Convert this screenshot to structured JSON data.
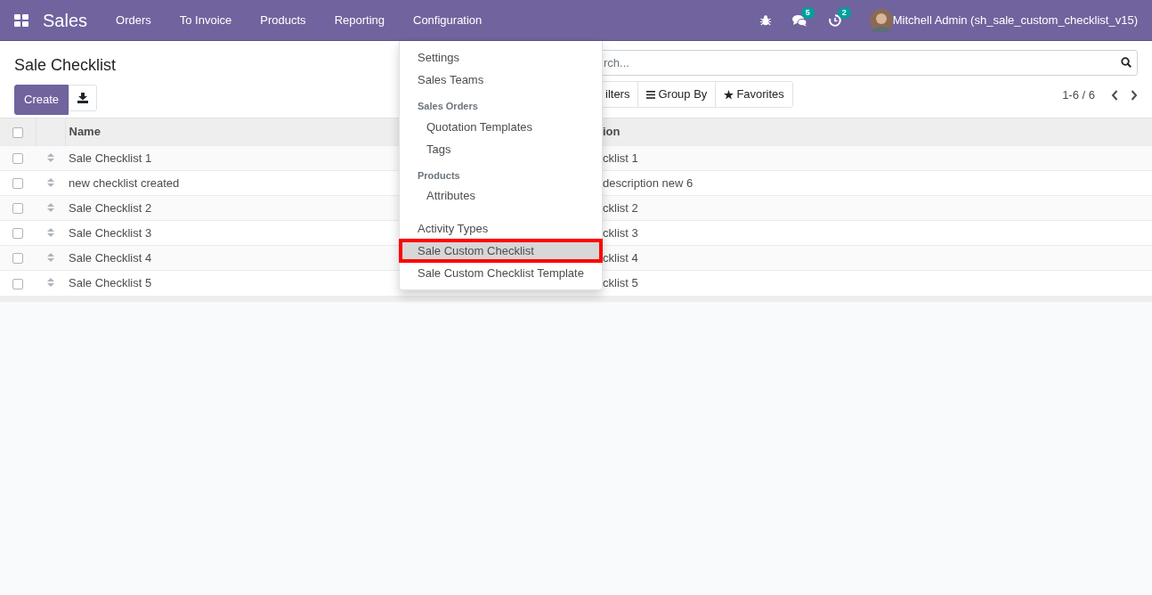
{
  "navbar": {
    "app_name": "Sales",
    "menu": [
      "Orders",
      "To Invoice",
      "Products",
      "Reporting",
      "Configuration"
    ],
    "systray": {
      "messages_count": "5",
      "activities_count": "2",
      "user": "Mitchell Admin (sh_sale_custom_checklist_v15)"
    }
  },
  "control_panel": {
    "title": "Sale Checklist",
    "create_button": "Create",
    "search": {
      "placeholder": "rch..."
    },
    "filter_buttons": [
      {
        "kind": "plain",
        "label": "ilters"
      },
      {
        "kind": "groupby",
        "label": "Group By"
      },
      {
        "kind": "favorites",
        "label": "Favorites"
      }
    ],
    "pager": "1-6 / 6"
  },
  "table": {
    "select_all_checked": false,
    "columns": [
      "Name",
      "ion"
    ],
    "rows": [
      {
        "checked": false,
        "name": "Sale Checklist 1",
        "column_2": "cklist 1"
      },
      {
        "checked": false,
        "name": "new checklist created",
        "column_2": "description new 6"
      },
      {
        "checked": false,
        "name": "Sale Checklist 2",
        "column_2": "cklist 2"
      },
      {
        "checked": false,
        "name": "Sale Checklist 3",
        "column_2": "cklist 3"
      },
      {
        "checked": false,
        "name": "Sale Checklist 4",
        "column_2": "cklist 4"
      },
      {
        "checked": false,
        "name": "Sale Checklist 5",
        "column_2": "cklist 5"
      }
    ]
  },
  "dropdown": {
    "items": [
      {
        "kind": "item",
        "label": "Settings",
        "selected": false,
        "annotated": false
      },
      {
        "kind": "item",
        "label": "Sales Teams",
        "selected": false,
        "annotated": false
      },
      {
        "kind": "header",
        "label": "Sales Orders",
        "children": [
          {
            "label": "Quotation Templates",
            "selected": false
          },
          {
            "label": "Tags",
            "selected": false
          }
        ]
      },
      {
        "kind": "header",
        "label": "Products",
        "children": [
          {
            "label": "Attributes",
            "selected": false
          }
        ]
      },
      {
        "kind": "item",
        "label": "Activity Types",
        "selected": false,
        "annotated": false
      },
      {
        "kind": "item",
        "label": "Sale Custom Checklist",
        "selected": true,
        "annotated": true
      },
      {
        "kind": "item",
        "label": "Sale Custom Checklist Template",
        "selected": false,
        "annotated": false
      }
    ]
  }
}
